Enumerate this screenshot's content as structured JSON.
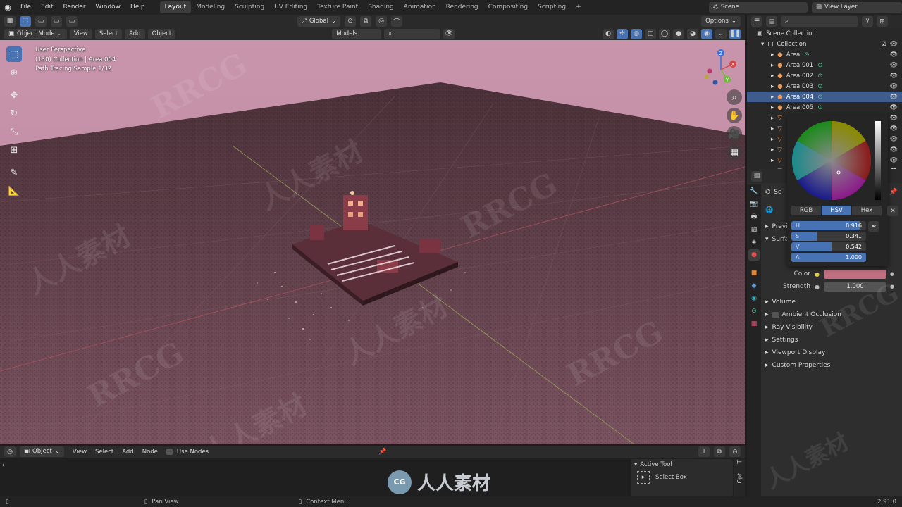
{
  "topbar": {
    "menus": [
      "File",
      "Edit",
      "Render",
      "Window",
      "Help"
    ],
    "workspaces": [
      "Layout",
      "Modeling",
      "Sculpting",
      "UV Editing",
      "Texture Paint",
      "Shading",
      "Animation",
      "Rendering",
      "Compositing",
      "Scripting"
    ],
    "active_workspace": "Layout",
    "add_workspace": "+",
    "scene_label": "Scene",
    "view_layer_label": "View Layer"
  },
  "tool_header": {
    "transform_orientation": "Global",
    "options_label": "Options"
  },
  "viewport_header": {
    "mode": "Object Mode",
    "menus": [
      "View",
      "Select",
      "Add",
      "Object"
    ],
    "collection_filter": "Models"
  },
  "viewport": {
    "overlay_lines": [
      "User Perspective",
      "(130) Collection | Area.004",
      "Path Tracing Sample 1/32"
    ],
    "gizmo_axes": {
      "x": "X",
      "y": "Y",
      "z": "Z"
    }
  },
  "outliner": {
    "root": "Scene Collection",
    "collection": "Collection",
    "items": [
      {
        "label": "Area",
        "selected": false
      },
      {
        "label": "Area.001",
        "selected": false
      },
      {
        "label": "Area.002",
        "selected": false
      },
      {
        "label": "Area.003",
        "selected": false
      },
      {
        "label": "Area.004",
        "selected": true
      },
      {
        "label": "Area.005",
        "selected": false
      }
    ]
  },
  "properties": {
    "partial_labels": [
      "Sc",
      "Previ",
      "Surfa"
    ],
    "color_label": "Color",
    "strength_label": "Strength",
    "strength_value": "1.000",
    "color_swatch": "#c07080",
    "panels": [
      "Volume",
      "Ambient Occlusion",
      "Ray Visibility",
      "Settings",
      "Viewport Display",
      "Custom Properties"
    ]
  },
  "color_picker": {
    "modes": [
      "RGB",
      "HSV",
      "Hex"
    ],
    "active_mode": "HSV",
    "sliders": [
      {
        "label": "H",
        "value": "0.916",
        "fraction": 0.916
      },
      {
        "label": "S",
        "value": "0.341",
        "fraction": 0.341
      },
      {
        "label": "V",
        "value": "0.542",
        "fraction": 0.542
      },
      {
        "label": "A",
        "value": "1.000",
        "fraction": 1.0
      }
    ]
  },
  "node_header": {
    "object_label": "Object",
    "menus": [
      "View",
      "Select",
      "Add",
      "Node"
    ],
    "use_nodes": "Use Nodes"
  },
  "active_tool": {
    "title": "Active Tool",
    "tool_name": "Select Box",
    "side_tab": "Opt"
  },
  "statusbar": {
    "pan_view": "Pan View",
    "context_menu": "Context Menu",
    "version": "2.91.0"
  },
  "watermarks": {
    "latin": "RRCG",
    "chinese": "人人素材"
  },
  "colors": {
    "accent": "#4772b3",
    "viewport_bg": "#6e4655",
    "sky": "#c48ba3"
  }
}
